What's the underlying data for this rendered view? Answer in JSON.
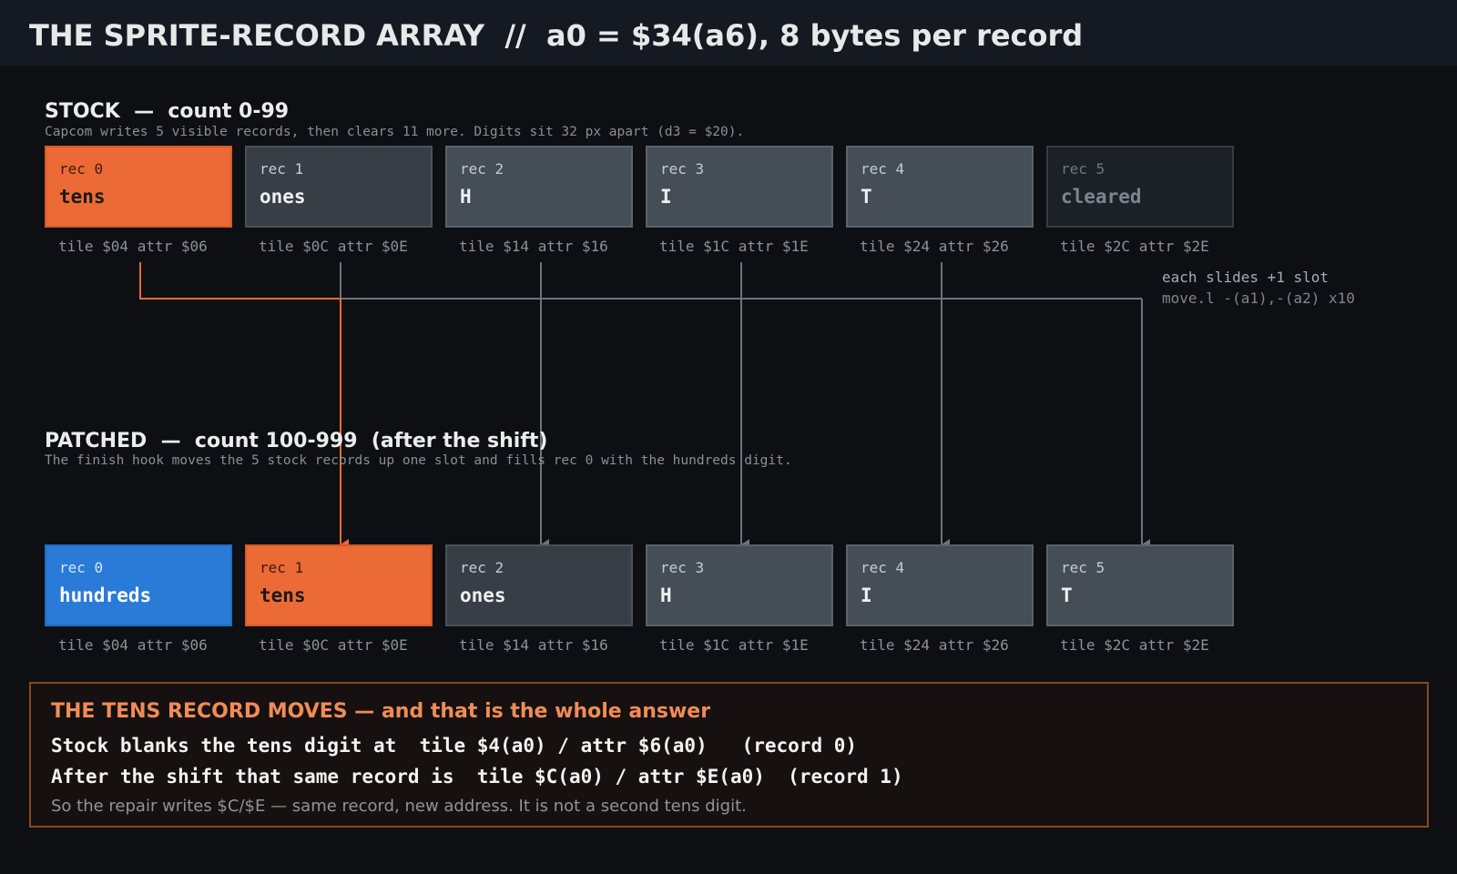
{
  "header": {
    "title": "THE SPRITE-RECORD ARRAY  //  a0 = $34(a6), 8 bytes per record"
  },
  "stock": {
    "title": "STOCK  —  count 0-99",
    "subtitle": "Capcom writes 5 visible records, then clears 11 more. Digits sit 32 px apart (d3 = $20).",
    "records": [
      {
        "label": "rec 0",
        "value": "tens",
        "tile": "tile $04 attr $06",
        "style": "orange"
      },
      {
        "label": "rec 1",
        "value": "ones",
        "tile": "tile $0C attr $0E",
        "style": "darkgray"
      },
      {
        "label": "rec 2",
        "value": "H",
        "tile": "tile $14 attr $16",
        "style": "gray"
      },
      {
        "label": "rec 3",
        "value": "I",
        "tile": "tile $1C attr $1E",
        "style": "gray"
      },
      {
        "label": "rec 4",
        "value": "T",
        "tile": "tile $24 attr $26",
        "style": "gray"
      },
      {
        "label": "rec 5",
        "value": "cleared",
        "tile": "tile $2C attr $2E",
        "style": "cleared"
      }
    ]
  },
  "shift_note": {
    "line1": "each slides +1 slot",
    "line2": "move.l -(a1),-(a2) x10"
  },
  "patched": {
    "title": "PATCHED  —  count 100-999  (after the shift)",
    "subtitle": "The finish hook moves the 5 stock records up one slot and fills rec 0 with the hundreds digit.",
    "records": [
      {
        "label": "rec 0",
        "value": "hundreds",
        "tile": "tile $04 attr $06",
        "style": "blue"
      },
      {
        "label": "rec 1",
        "value": "tens",
        "tile": "tile $0C attr $0E",
        "style": "orange"
      },
      {
        "label": "rec 2",
        "value": "ones",
        "tile": "tile $14 attr $16",
        "style": "darkgray"
      },
      {
        "label": "rec 3",
        "value": "H",
        "tile": "tile $1C attr $1E",
        "style": "gray"
      },
      {
        "label": "rec 4",
        "value": "I",
        "tile": "tile $24 attr $26",
        "style": "gray"
      },
      {
        "label": "rec 5",
        "value": "T",
        "tile": "tile $2C attr $2E",
        "style": "gray"
      }
    ]
  },
  "answer": {
    "title": "THE TENS RECORD MOVES — and that is the whole answer",
    "line1": "Stock blanks the tens digit at  tile $4(a0) / attr $6(a0)   (record 0)",
    "line2": "After the shift that same record is  tile $C(a0) / attr $E(a0)  (record 1)",
    "footnote": "So the repair writes $C/$E — same record, new address. It is not a second tens digit."
  },
  "colors": {
    "accent_orange": "#ec6a36",
    "accent_blue": "#2a7bd8",
    "arrow_gray": "#6b747e",
    "answer_title": "#f08c57"
  }
}
